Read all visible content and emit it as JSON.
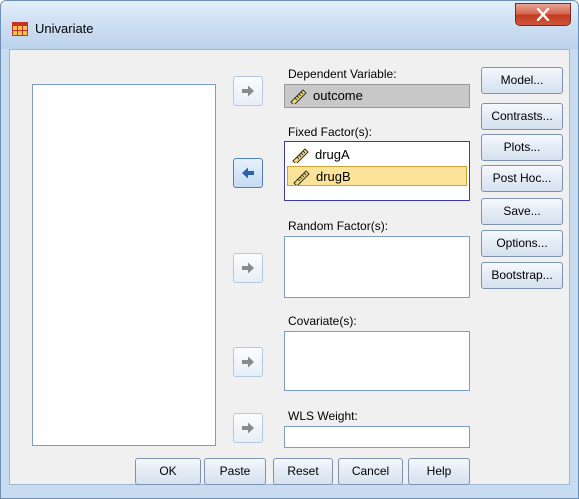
{
  "window": {
    "title": "Univariate",
    "close_label": "x"
  },
  "source_list": {
    "items": []
  },
  "dependent": {
    "label": "Dependent Variable:",
    "value": "outcome"
  },
  "fixed": {
    "label": "Fixed Factor(s):",
    "items": [
      "drugA",
      "drugB"
    ],
    "selected_index": 1
  },
  "random": {
    "label": "Random Factor(s):"
  },
  "covariates": {
    "label": "Covariate(s):"
  },
  "wls": {
    "label": "WLS Weight:",
    "value": ""
  },
  "side_buttons": {
    "model": "Model...",
    "contrasts": "Contrasts...",
    "plots": "Plots...",
    "posthoc": "Post Hoc...",
    "save": "Save...",
    "options": "Options...",
    "bootstrap": "Bootstrap..."
  },
  "bottom_buttons": {
    "ok": "OK",
    "paste": "Paste",
    "reset": "Reset",
    "cancel": "Cancel",
    "help": "Help"
  },
  "colors": {
    "selection": "#fbe49a",
    "dependent_bg": "#c8c8c8",
    "active_arrow": "#2f5fb0",
    "arrow": "#8a8a8a"
  }
}
